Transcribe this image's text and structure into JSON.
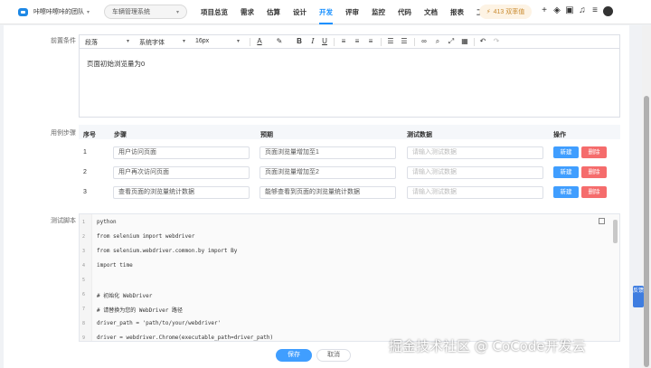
{
  "topbar": {
    "team_name": "咔嚓咔嚓咔的团队",
    "project": "车辆管理系统",
    "nav": [
      "项目总览",
      "需求",
      "估算",
      "设计",
      "开发",
      "评审",
      "监控",
      "代码",
      "文档",
      "报表",
      "工具"
    ],
    "active_nav": "开发",
    "upgrade_label": "413 双率值"
  },
  "form": {
    "precondition_label": "前置条件",
    "toolbar": {
      "paragraph": "段落",
      "font": "系统字体",
      "size": "16px"
    },
    "precondition_text": "页面初始浏览量为0",
    "steps_label": "用例步骤",
    "columns": {
      "no": "序号",
      "step": "步骤",
      "expected": "预期",
      "test_data": "测试数据",
      "action": "操作"
    },
    "steps": [
      {
        "no": "1",
        "step": "用户访问页面",
        "expected": "页面浏览量增加至1",
        "test_data_placeholder": "请输入测试数据",
        "new": "新建",
        "delete": "删除"
      },
      {
        "no": "2",
        "step": "用户再次访问页面",
        "expected": "页面浏览量增加至2",
        "test_data_placeholder": "请输入测试数据",
        "new": "新建",
        "delete": "删除"
      },
      {
        "no": "3",
        "step": "查看页面的浏览量统计数据",
        "expected": "能够查看到页面的浏览量统计数据",
        "test_data_placeholder": "请输入测试数据",
        "new": "新建",
        "delete": "删除"
      }
    ],
    "script_label": "测试脚本",
    "code_lines": [
      "python",
      "from selenium import webdriver",
      "from selenium.webdriver.common.by import By",
      "import time",
      "",
      "# 初始化 WebDriver",
      "# 请替换为您的 WebDriver 路径",
      "driver_path = 'path/to/your/webdriver'",
      "driver = webdriver.Chrome(executable_path=driver_path)"
    ],
    "save": "保存",
    "cancel": "取消"
  },
  "feedback": "反馈",
  "watermark": "掘金技术社区 @ CoCode开发云"
}
